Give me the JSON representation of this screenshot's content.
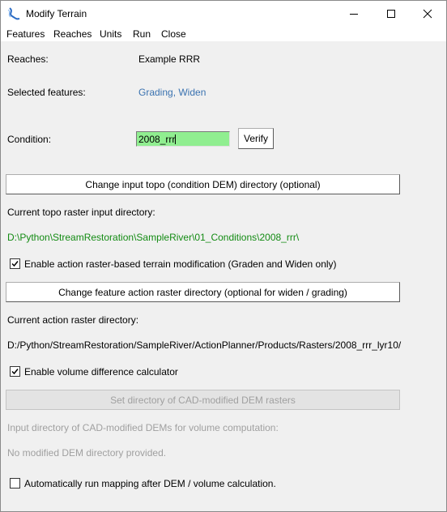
{
  "window": {
    "title": "Modify Terrain",
    "icon": "river-icon",
    "controls": {
      "minimize": "minimize-icon",
      "maximize": "maximize-icon",
      "close": "close-icon"
    }
  },
  "menu": {
    "items": [
      "Features",
      "Reaches",
      "Units",
      "Run",
      "Close"
    ]
  },
  "reaches": {
    "label": "Reaches:",
    "value": "Example RRR"
  },
  "selected_features": {
    "label": "Selected features:",
    "value": "Grading, Widen"
  },
  "condition": {
    "label": "Condition:",
    "value": "2008_rrr",
    "verify_label": "Verify",
    "accent": "#90ee90"
  },
  "topo": {
    "button_label": "Change input topo (condition DEM) directory (optional)",
    "dir_label": "Current topo raster input directory:",
    "dir_value": "D:\\Python\\StreamRestoration\\SampleRiver\\01_Conditions\\2008_rrr\\",
    "color": "#138b13"
  },
  "action_raster": {
    "checkbox_label": "Enable action raster-based terrain modification (Graden and Widen only)",
    "checked": true,
    "button_label": "Change feature action raster directory (optional for widen / grading)",
    "dir_label": "Current action raster directory:",
    "dir_value": "D:/Python/StreamRestoration/SampleRiver/ActionPlanner/Products/Rasters/2008_rrr_lyr10/"
  },
  "volume": {
    "checkbox_label": "Enable volume difference calculator",
    "checked": true,
    "button_label": "Set directory of CAD-modified DEM rasters",
    "dir_label": "Input directory of CAD-modified DEMs for volume computation:",
    "dir_value": "No modified DEM directory provided."
  },
  "auto_run": {
    "checkbox_label": "Automatically run mapping after DEM / volume calculation.",
    "checked": false
  }
}
